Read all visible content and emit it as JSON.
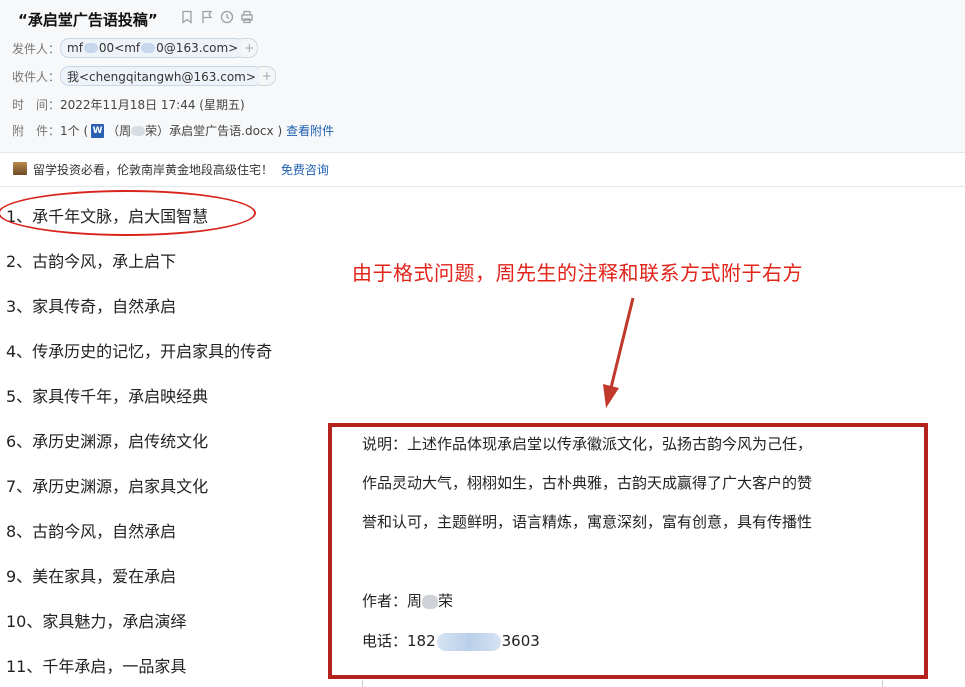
{
  "mail": {
    "subject": "“承启堂广告语投稿”",
    "from_label": "发件人：",
    "from_a": "mf",
    "from_b": "00<mf",
    "from_c": "0@163.com>",
    "to_label": "收件人：",
    "to_value": "我<chengqitangwh@163.com>",
    "time_label": "时　间：",
    "time_value": "2022年11月18日 17:44 (星期五)",
    "attach_label": "附　件：",
    "attach_count": "1个 (",
    "attach_name_pre": "（周",
    "attach_name_post": "荣）承启堂广告语.docx )",
    "attach_view": "查看附件",
    "plus": "+",
    "word_icon": "W"
  },
  "ad": {
    "text": "留学投资必看，伦敦南岸黄金地段高级住宅！",
    "link": "免费咨询"
  },
  "slogans": [
    "1、承千年文脉，启大国智慧",
    "2、古韵今风，承上启下",
    "3、家具传奇，自然承启",
    "4、传承历史的记忆，开启家具的传奇",
    "5、家具传千年，承启映经典",
    "6、承历史渊源，启传统文化",
    "7、承历史渊源，启家具文化",
    "8、古韵今风，自然承启",
    "9、美在家具，爱在承启",
    "10、家具魅力，承启演绎",
    "11、千年承启，一品家具"
  ],
  "annotation": "由于格式问题，周先生的注释和联系方式附于右方",
  "note": {
    "line1": "说明：上述作品体现承启堂以传承徽派文化，弘扬古韵今风为己任，",
    "line2": "作品灵动大气，栩栩如生，古朴典雅，古韵天成赢得了广大客户的赞",
    "line3": "誉和认可，主题鲜明，语言精炼，寓意深刻，富有创意，具有传播性",
    "author_pre": "作者：周",
    "author_post": "荣",
    "phone_pre": "电话：182",
    "phone_post": "3603"
  },
  "colors": {
    "accent_red": "#d9241c",
    "link_blue": "#1f5fb0",
    "box_border": "#b3231b"
  }
}
